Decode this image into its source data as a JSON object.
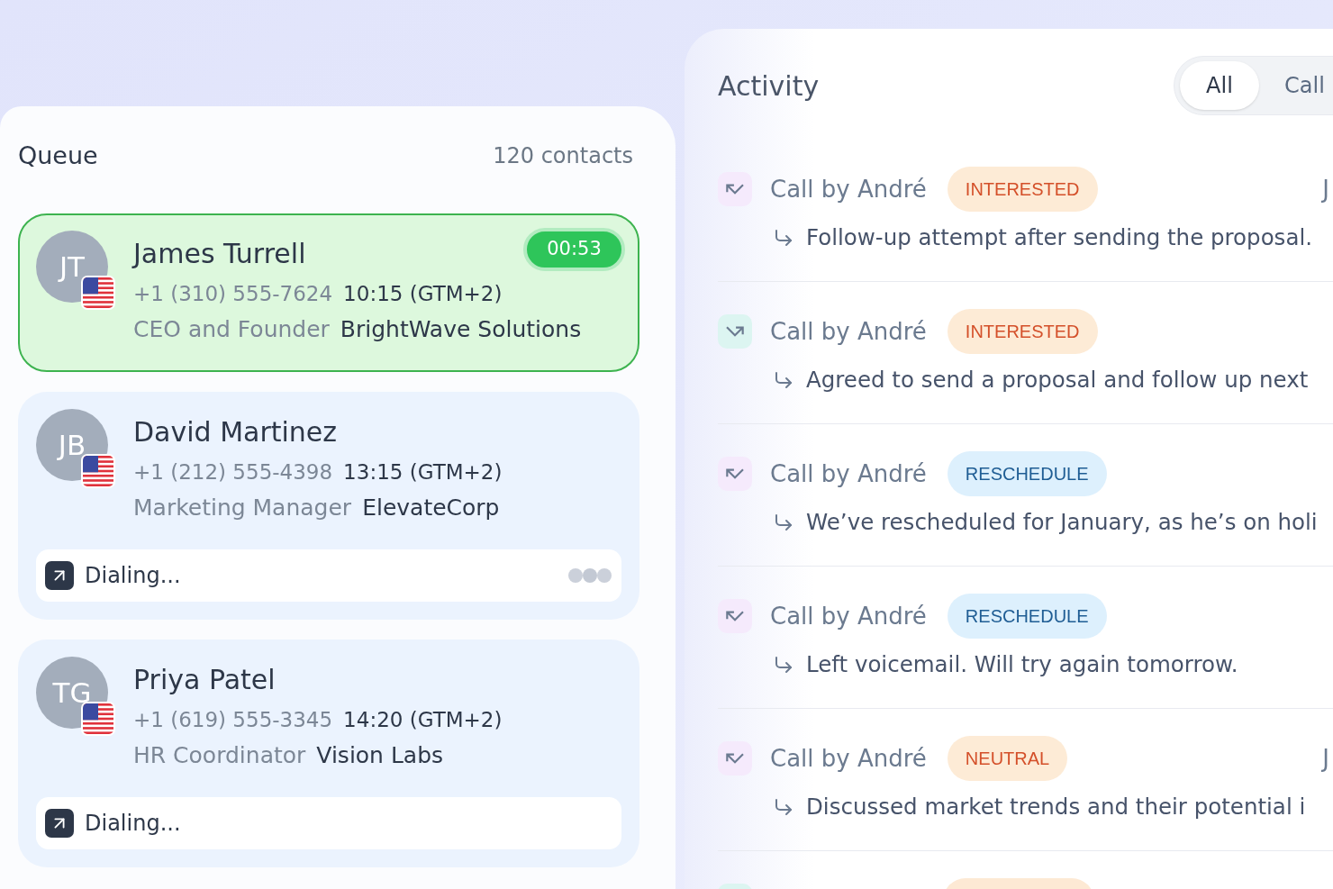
{
  "queue": {
    "title": "Queue",
    "count": "120 contacts",
    "contacts": [
      {
        "initials": "JT",
        "name": "James Turrell",
        "phone": "+1 (310) 555-7624",
        "local_time": "10:15 (GTM+2)",
        "title": "CEO and Founder",
        "company": "BrightWave Solutions",
        "selected": true,
        "timer": "00:53"
      },
      {
        "initials": "JB",
        "name": "David Martinez",
        "phone": "+1 (212) 555-4398",
        "local_time": "13:15 (GTM+2)",
        "title": "Marketing Manager",
        "company": "ElevateCorp",
        "selected": false,
        "status": "Dialing...",
        "loading": true
      },
      {
        "initials": "TG",
        "name": "Priya Patel",
        "phone": "+1 (619) 555-3345",
        "local_time": "14:20 (GTM+2)",
        "title": "HR Coordinator",
        "company": "Vision Labs",
        "selected": false,
        "status": "Dialing...",
        "loading": false
      }
    ]
  },
  "activity": {
    "title": "Activity",
    "tabs": [
      {
        "label": "All",
        "selected": true
      },
      {
        "label": "Call",
        "selected": false
      }
    ],
    "items": [
      {
        "kind": "inbound",
        "title": "Call by André",
        "tag": "INTERESTED",
        "color": "#d4502a",
        "note": "Follow-up attempt after sending the proposal.",
        "date": "J"
      },
      {
        "kind": "outbound",
        "title": "Call by André",
        "tag": "INTERESTED",
        "color": "#d4502a",
        "note": "Agreed to send a proposal and follow up next"
      },
      {
        "kind": "inbound",
        "title": "Call by André",
        "tag": "RESCHEDULE",
        "color": "#1f5d94",
        "note": "We’ve rescheduled for January, as he’s on holi"
      },
      {
        "kind": "inbound",
        "title": "Call by André",
        "tag": "RESCHEDULE",
        "color": "#1f5d94",
        "note": "Left voicemail. Will try again tomorrow."
      },
      {
        "kind": "inbound",
        "title": "Call by André",
        "tag": "NEUTRAL",
        "color": "#d4502a",
        "note": "Discussed market trends and their potential i",
        "date": "J"
      },
      {
        "kind": "outbound",
        "color": "#fde9d4"
      }
    ]
  }
}
